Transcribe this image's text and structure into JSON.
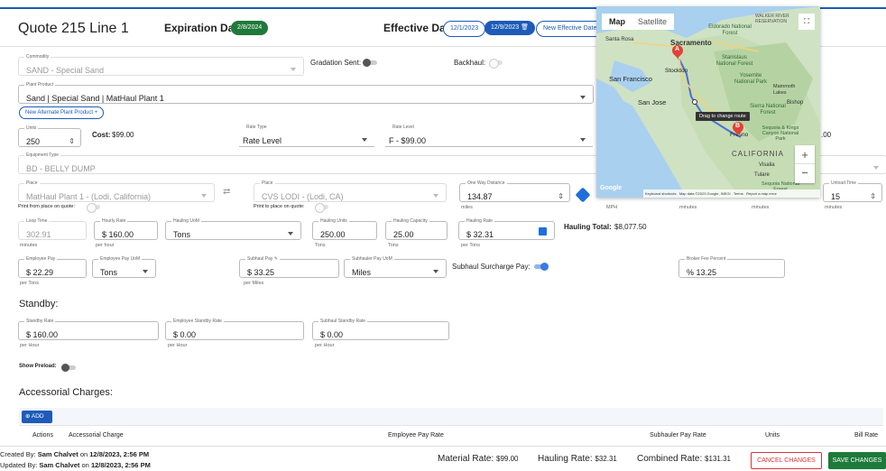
{
  "header": {
    "title": "Quote 215 Line 1",
    "expiration_label": "Expiration Date:",
    "expiration_date": "2/8/2024",
    "effective_label": "Effective Date:",
    "effective_date_1": "12/1/2023",
    "effective_date_2": "12/9/2023",
    "new_effective_btn": "New Effective Date +"
  },
  "commodity": {
    "label": "Commodity",
    "value": "SAND - Special Sand"
  },
  "gradation": {
    "label": "Gradation Sent:"
  },
  "backhaul": {
    "label": "Backhaul:"
  },
  "plant_product": {
    "label": "Plant Product",
    "value": "Sand | Special Sand | MatHaul Plant 1"
  },
  "alt_plant_btn": "New Alternate Plant Product +",
  "units": {
    "label": "Units",
    "value": "250"
  },
  "cost": {
    "label": "Cost:",
    "value": "$99.00"
  },
  "rate_type": {
    "label": "Rate Type",
    "value": "Rate Level"
  },
  "rate_level": {
    "label": "Rate Level",
    "value": "F - $99.00"
  },
  "right_partial": ".00",
  "equipment": {
    "label": "Equipment Type",
    "value": "BD - BELLY DUMP"
  },
  "place_from": {
    "label": "Place",
    "value": "MatHaul Plant 1 - (Lodi, California)",
    "print_label": "Print from place on quote:"
  },
  "place_to": {
    "label": "Place",
    "value": "CVS LODI - (Lodi, CA)",
    "print_label": "Print to place on quote:"
  },
  "distance": {
    "label": "One Way Distance",
    "value": "134.87",
    "unit": "miles"
  },
  "mph_hint": "MPH",
  "minutes_hint": "minutes",
  "unload": {
    "label": "Unload Time",
    "value": "15",
    "unit": "minutes"
  },
  "loop_time": {
    "label": "Loop Time",
    "value": "302.91",
    "unit": "minutes"
  },
  "hourly_rate": {
    "label": "Hourly Rate",
    "value": "$ 160.00",
    "unit": "per hour"
  },
  "hauling_uom": {
    "label": "Hauling UoM",
    "value": "Tons"
  },
  "hauling_units": {
    "label": "Hauling Units",
    "value": "250.00",
    "unit": "Tons"
  },
  "hauling_capacity": {
    "label": "Hauling Capacity",
    "value": "25.00",
    "unit": "Tons"
  },
  "hauling_rate": {
    "label": "Hauling Rate",
    "value": "$ 32.31",
    "unit": "per Tons"
  },
  "hauling_total": {
    "label": "Hauling Total:",
    "value": "$8,077.50"
  },
  "employee_pay": {
    "label": "Employee Pay",
    "value": "$ 22.29",
    "unit": "per Tons"
  },
  "employee_pay_uom": {
    "label": "Employee Pay UoM",
    "value": "Tons"
  },
  "subhaul_pay": {
    "label": "Subhaul Pay",
    "value": "$ 33.25",
    "unit": "per Miles"
  },
  "subhauler_pay_uom": {
    "label": "Subhauler Pay UoM",
    "value": "Miles"
  },
  "subhaul_surcharge": {
    "label": "Subhaul Surcharge Pay:"
  },
  "broker_fee": {
    "label": "Broker Fee Percent",
    "value": "% 13.25"
  },
  "standby": {
    "title": "Standby:",
    "rate": {
      "label": "Standby Rate",
      "value": "$ 160.00",
      "unit": "per Hour"
    },
    "employee": {
      "label": "Employee Standby Rate",
      "value": "$ 0.00",
      "unit": "per Hour"
    },
    "subhaul": {
      "label": "Subhaul Standby Rate",
      "value": "$ 0.00",
      "unit": "per Hour"
    }
  },
  "show_preload": {
    "label": "Show Preload:"
  },
  "accessorial": {
    "title": "Accessorial Charges:",
    "add_btn": "ADD",
    "columns": [
      "Actions",
      "Accessorial Charge",
      "Employee Pay Rate",
      "Subhauler Pay Rate",
      "Units",
      "Bill Rate"
    ]
  },
  "map": {
    "tab_map": "Map",
    "tab_satellite": "Satellite",
    "tooltip": "Drag to change route",
    "marker_a": "A",
    "marker_b": "B",
    "cities": [
      "Sacramento",
      "Santa Rosa",
      "San Francisco",
      "Stockton",
      "San Jose",
      "Fresno",
      "CALIFORNIA",
      "Visalia",
      "Tulare",
      "Bishop",
      "Mammoth Lakes",
      "Eldorado National Forest",
      "Stanislaus National Forest",
      "Yosemite National Park",
      "Sierra National Forest",
      "Sequoia & Kings Canyon National Park",
      "WALKER RIVER RESERVATION",
      "Sequoia National Forest"
    ],
    "attribution": [
      "Google",
      "Keyboard shortcuts",
      "Map data ©2023 Google, INEGI",
      "Terms",
      "Report a map error"
    ]
  },
  "footer": {
    "created_prefix": "Created By:",
    "created_by": "Sam Chalvet",
    "created_on": "on",
    "created_date": "12/8/2023, 2:56 PM",
    "updated_prefix": "Updated By:",
    "updated_by": "Sam Chalvet",
    "updated_on": "on",
    "updated_date": "12/8/2023, 2:56 PM",
    "material_rate_label": "Material Rate:",
    "material_rate": "$99.00",
    "hauling_rate_label": "Hauling Rate:",
    "hauling_rate": "$32.31",
    "combined_rate_label": "Combined Rate:",
    "combined_rate": "$131.31",
    "cancel_btn": "CANCEL CHANGES",
    "save_btn": "SAVE CHANGES"
  }
}
